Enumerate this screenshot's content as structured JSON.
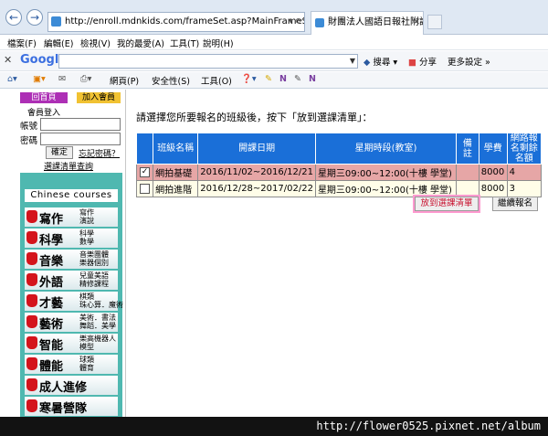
{
  "browser": {
    "address": "http://enroll.mdnkids.com/frameSet.asp?MainFrameSrc=",
    "tab_title": "財團法人國語日報社附設合...",
    "back": "←",
    "forward": "→"
  },
  "menubar": [
    "檔案(F)",
    "編輯(E)",
    "檢視(V)",
    "我的最愛(A)",
    "工具(T)",
    "說明(H)"
  ],
  "google_toolbar": {
    "logo": "Google",
    "search": "搜尋",
    "share": "分享",
    "more": "更多設定 »"
  },
  "command_bar": [
    "網頁(P)",
    "安全性(S)",
    "工具(O)"
  ],
  "left": {
    "tab_home": "回首頁",
    "tab_join": "加入會員",
    "login_title": "會員登入",
    "account_label": "帳號",
    "password_label": "密碼",
    "confirm_button": "確定",
    "forgot_link": "忘記密碼？",
    "query_link": "選課清單查詢",
    "courses_title": "Chinese courses",
    "courses": [
      {
        "big": "寫作",
        "sm1": "寫作",
        "sm2": "演說"
      },
      {
        "big": "科學",
        "sm1": "科學",
        "sm2": "數學"
      },
      {
        "big": "音樂",
        "sm1": "音樂團體",
        "sm2": "樂器個別"
      },
      {
        "big": "外語",
        "sm1": "兒童美語",
        "sm2": "精修課程"
      },
      {
        "big": "才藝",
        "sm1": "棋類",
        "sm2": "珠心算．魔術"
      },
      {
        "big": "藝術",
        "sm1": "美術．書法",
        "sm2": "舞蹈．美學"
      },
      {
        "big": "智能",
        "sm1": "樂高機器人",
        "sm2": "模型"
      },
      {
        "big": "體能",
        "sm1": "球類",
        "sm2": "體育"
      },
      {
        "big": "成人進修",
        "sm1": "",
        "sm2": ""
      },
      {
        "big": "寒暑營隊",
        "sm1": "",
        "sm2": ""
      }
    ]
  },
  "main": {
    "instruction": "請選擇您所要報名的班級後，按下「放到選課清單」：",
    "headers": [
      "班級名稱",
      "開課日期",
      "星期時段(教室)",
      "備註",
      "學費",
      "網路報名剩餘名額"
    ],
    "rows": [
      {
        "checked": "✓",
        "name": "網拍基礎",
        "dates": "2016/11/02~2016/12/21",
        "time": "星期三09:00~12:00(十樓 學堂)",
        "note": "",
        "fee": "8000",
        "seats": "4"
      },
      {
        "checked": "",
        "name": "網拍進階",
        "dates": "2016/12/28~2017/02/22",
        "time": "星期三09:00~12:00(十樓 學堂)",
        "note": "",
        "fee": "8000",
        "seats": "3"
      }
    ],
    "add_button": "放到選課清單",
    "continue_button": "繼續報名"
  },
  "watermark": "http://flower0525.pixnet.net/album"
}
